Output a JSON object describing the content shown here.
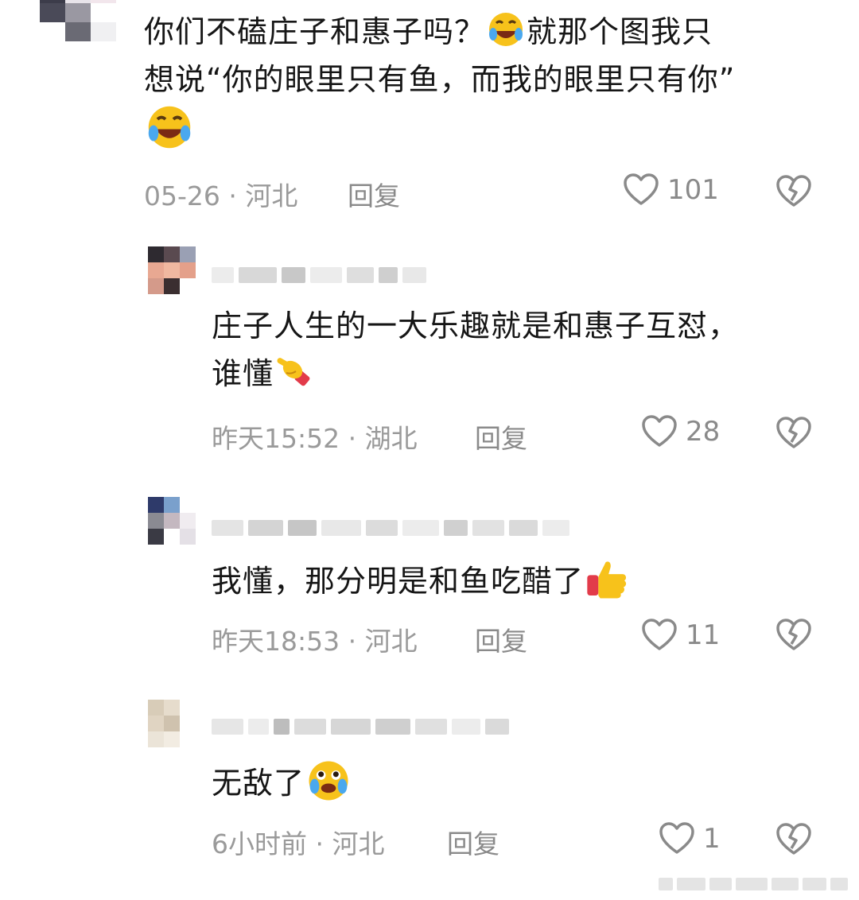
{
  "comments": [
    {
      "text_lines": [
        "你们不磕庄子和惠子吗？",
        "就那个图我只",
        "想说“你的眼里只有鱼，而我的眼里只有你”"
      ],
      "date": "05-26",
      "location": "河北",
      "reply_label": "回复",
      "likes": "101",
      "emoji_inline": "laugh-cry-emoji",
      "emoji_trailing": "laugh-cry-emoji"
    },
    {
      "text_lines": [
        "庄子人生的一大乐趣就是和惠子互怼，",
        "谁懂"
      ],
      "date": "昨天15:52",
      "location": "湖北",
      "reply_label": "回复",
      "likes": "28",
      "emoji_trailing": "pointing-hand-emoji"
    },
    {
      "text_lines": [
        "我懂，那分明是和鱼吃醋了"
      ],
      "date": "昨天18:53",
      "location": "河北",
      "reply_label": "回复",
      "likes": "11",
      "emoji_trailing": "thumbs-up-emoji"
    },
    {
      "text_lines": [
        "无敌了"
      ],
      "date": "6小时前",
      "location": "河北",
      "reply_label": "回复",
      "likes": "1",
      "emoji_trailing": "tearful-smile-emoji"
    }
  ],
  "meta_separator": "·",
  "colors": {
    "text": "#161616",
    "meta": "#9a9a9a",
    "icon": "#8a8a8a",
    "emoji_yellow": "#f7c21b"
  }
}
